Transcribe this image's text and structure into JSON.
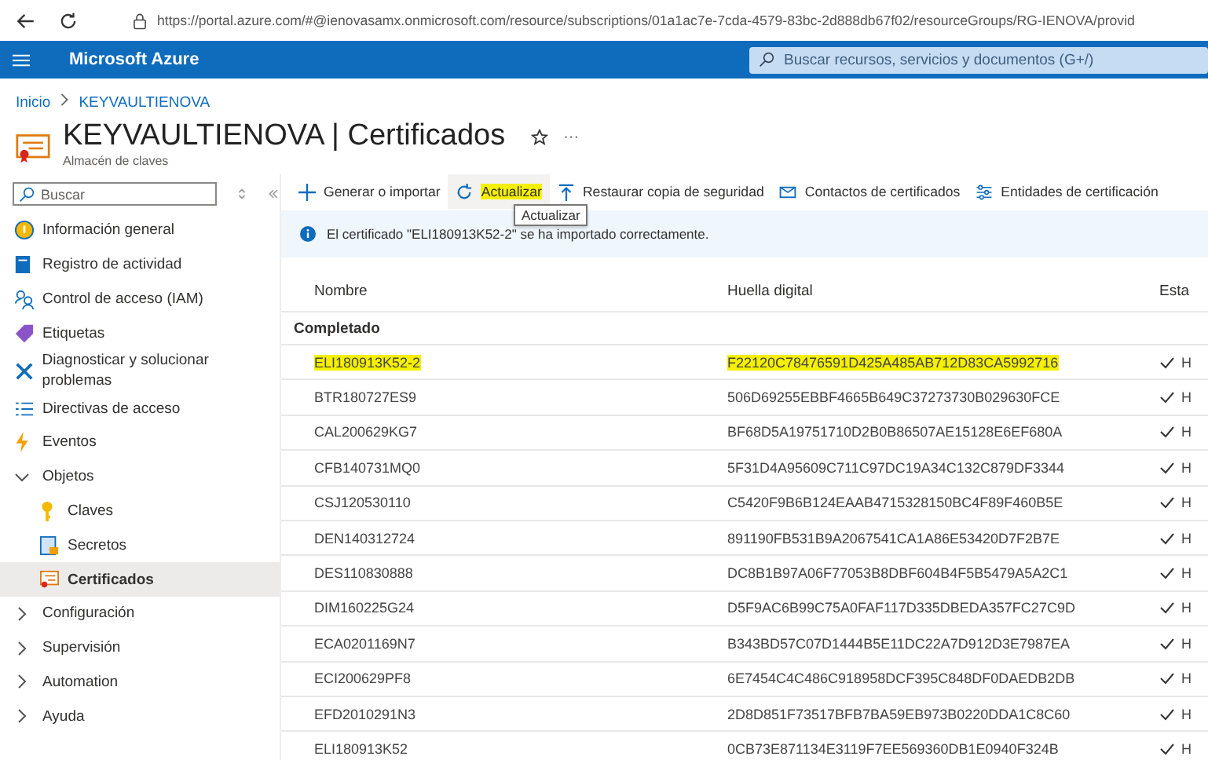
{
  "browser": {
    "url": "https://portal.azure.com/#@ienovasamx.onmicrosoft.com/resource/subscriptions/01a1ac7e-7cda-4579-83bc-2d888db67f02/resourceGroups/RG-IENOVA/provid"
  },
  "topbar": {
    "brand": "Microsoft Azure",
    "search_placeholder": "Buscar recursos, servicios y documentos (G+/)"
  },
  "breadcrumb": [
    "Inicio",
    "KEYVAULTIENOVA"
  ],
  "page": {
    "title": "KEYVAULTIENOVA | Certificados",
    "subtitle": "Almacén de claves",
    "more": "···"
  },
  "sidebar": {
    "search_placeholder": "Buscar",
    "items": [
      {
        "label": "Información general",
        "selected": false
      },
      {
        "label": "Registro de actividad",
        "selected": false
      },
      {
        "label": "Control de acceso (IAM)",
        "selected": false
      },
      {
        "label": "Etiquetas",
        "selected": false
      },
      {
        "label": "Diagnosticar y solucionar problemas",
        "selected": false
      },
      {
        "label": "Directivas de acceso",
        "selected": false
      },
      {
        "label": "Eventos",
        "selected": false
      },
      {
        "label": "Objetos",
        "expanded": true,
        "selected": false,
        "children": [
          {
            "label": "Claves",
            "selected": false
          },
          {
            "label": "Secretos",
            "selected": false
          },
          {
            "label": "Certificados",
            "selected": true
          }
        ]
      },
      {
        "label": "Configuración",
        "expanded": false,
        "selected": false
      },
      {
        "label": "Supervisión",
        "expanded": false,
        "selected": false
      },
      {
        "label": "Automation",
        "expanded": false,
        "selected": false
      },
      {
        "label": "Ayuda",
        "expanded": false,
        "selected": false
      }
    ]
  },
  "toolbar": [
    {
      "label": "Generar o importar",
      "hovered": false,
      "highlighted": false
    },
    {
      "label": "Actualizar",
      "hovered": true,
      "highlighted": true
    },
    {
      "label": "Restaurar copia de seguridad",
      "hovered": false,
      "highlighted": false
    },
    {
      "label": "Contactos de certificados",
      "hovered": false,
      "highlighted": false
    },
    {
      "label": "Entidades de certificación",
      "hovered": false,
      "highlighted": false
    }
  ],
  "tooltip": "Actualizar",
  "notice": "El certificado \"ELI180913K52-2\" se ha importado correctamente.",
  "table": {
    "columns": [
      "Nombre",
      "Huella digital",
      "Esta"
    ],
    "group": "Completado",
    "rows": [
      {
        "name": "ELI180913K52-2",
        "thumbprint": "F22120C78476591D425A485AB712D83CA5992716",
        "status": "H",
        "highlighted": true
      },
      {
        "name": "BTR180727ES9",
        "thumbprint": "506D69255EBBF4665B649C37273730B029630FCE",
        "status": "H",
        "highlighted": false
      },
      {
        "name": "CAL200629KG7",
        "thumbprint": "BF68D5A19751710D2B0B86507AE15128E6EF680A",
        "status": "H",
        "highlighted": false
      },
      {
        "name": "CFB140731MQ0",
        "thumbprint": "5F31D4A95609C711C97DC19A34C132C879DF3344",
        "status": "H",
        "highlighted": false
      },
      {
        "name": "CSJ120530110",
        "thumbprint": "C5420F9B6B124EAAB4715328150BC4F89F460B5E",
        "status": "H",
        "highlighted": false
      },
      {
        "name": "DEN140312724",
        "thumbprint": "891190FB531B9A2067541CA1A86E53420D7F2B7E",
        "status": "H",
        "highlighted": false
      },
      {
        "name": "DES110830888",
        "thumbprint": "DC8B1B97A06F77053B8DBF604B4F5B5479A5A2C1",
        "status": "H",
        "highlighted": false
      },
      {
        "name": "DIM160225G24",
        "thumbprint": "D5F9AC6B99C75A0FAF117D335DBEDA357FC27C9D",
        "status": "H",
        "highlighted": false
      },
      {
        "name": "ECA0201169N7",
        "thumbprint": "B343BD57C07D1444B5E11DC22A7D912D3E7987EA",
        "status": "H",
        "highlighted": false
      },
      {
        "name": "ECI200629PF8",
        "thumbprint": "6E7454C4C486C918958DCF395C848DF0DAEDB2DB",
        "status": "H",
        "highlighted": false
      },
      {
        "name": "EFD2010291N3",
        "thumbprint": "2D8D851F73517BFB7BA59EB973B0220DDA1C8C60",
        "status": "H",
        "highlighted": false
      },
      {
        "name": "ELI180913K52",
        "thumbprint": "0CB73E871134E3119F7EE569360DB1E0940F324B",
        "status": "H",
        "highlighted": false
      }
    ]
  }
}
